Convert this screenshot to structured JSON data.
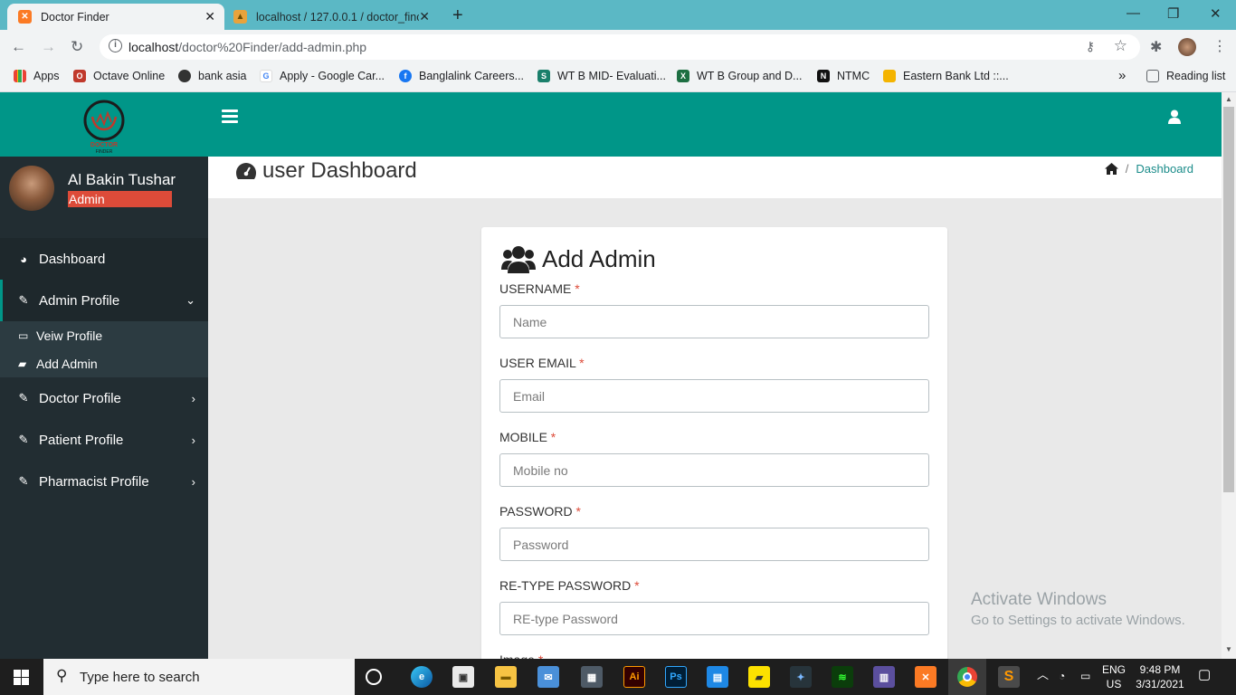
{
  "browser": {
    "tabs": [
      {
        "title": "Doctor Finder",
        "icon": "xampp-icon"
      },
      {
        "title": "localhost / 127.0.0.1 / doctor_finc",
        "icon": "phpmyadmin-icon"
      }
    ],
    "url_host": "localhost",
    "url_path": "/doctor%20Finder/add-admin.php",
    "bookmarks": [
      {
        "label": "Apps"
      },
      {
        "label": "Octave Online"
      },
      {
        "label": "bank asia"
      },
      {
        "label": "Apply - Google Car..."
      },
      {
        "label": "Banglalink Careers..."
      },
      {
        "label": "WT B MID- Evaluati..."
      },
      {
        "label": "WT B Group and D..."
      },
      {
        "label": "NTMC"
      },
      {
        "label": "Eastern Bank Ltd ::..."
      }
    ],
    "more_bookmarks": "»",
    "reading_list": "Reading list"
  },
  "sidebar": {
    "user_name": "Al Bakin Tushar",
    "user_role": "Admin",
    "menu": {
      "dashboard": "Dashboard",
      "admin_profile": "Admin Profile",
      "view_profile": "Veiw Profile",
      "add_admin": "Add Admin",
      "doctor_profile": "Doctor Profile",
      "patient_profile": "Patient Profile",
      "pharmacist_profile": "Pharmacist Profile"
    }
  },
  "page": {
    "title": "user Dashboard",
    "breadcrumb": "Dashboard"
  },
  "form": {
    "heading": "Add Admin",
    "fields": [
      {
        "label": "USERNAME",
        "placeholder": "Name"
      },
      {
        "label": "USER EMAIL",
        "placeholder": "Email"
      },
      {
        "label": "MOBILE",
        "placeholder": "Mobile no"
      },
      {
        "label": "PASSWORD",
        "placeholder": "Password"
      },
      {
        "label": "RE-TYPE PASSWORD",
        "placeholder": "RE-type Password"
      }
    ],
    "next_label": "Image"
  },
  "watermark": {
    "line1": "Activate Windows",
    "line2": "Go to Settings to activate Windows."
  },
  "taskbar": {
    "search_placeholder": "Type here to search",
    "lang": "ENG",
    "region": "US",
    "time": "9:48 PM",
    "date": "3/31/2021"
  },
  "colors": {
    "primary": "#009688",
    "sidebar": "#222d32",
    "danger": "#dd4b39"
  }
}
